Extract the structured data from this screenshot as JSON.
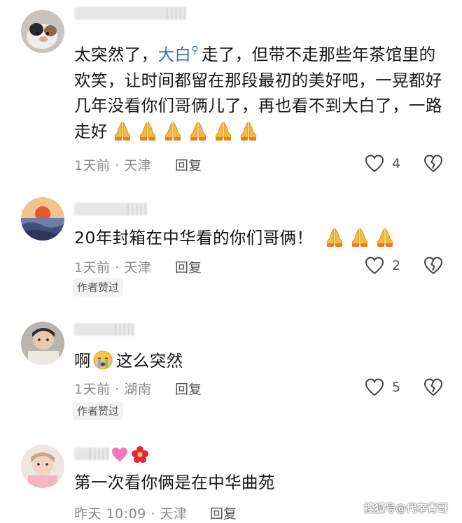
{
  "comments": [
    {
      "text_before": "太突然了，",
      "link_text": "大白",
      "link_icon": "search-icon",
      "text_after": "走了，但带不走那些年茶馆里的欢笑，让时间都留在那段最初的美好吧，一晃都好几年没看你们哥俩儿了，再也看不到大白了，一路走好",
      "emoji": [
        "folded-hands",
        "folded-hands",
        "folded-hands",
        "folded-hands",
        "folded-hands",
        "folded-hands"
      ],
      "time": "1天前",
      "location": "天津",
      "reply_label": "回复",
      "likes": "4"
    },
    {
      "text": "20年封箱在中华看的你们哥俩！",
      "emoji": [
        "folded-hands",
        "folded-hands",
        "folded-hands"
      ],
      "time": "1天前",
      "location": "天津",
      "reply_label": "回复",
      "likes": "2",
      "author_liked": "作者赞过"
    },
    {
      "text_before": "啊",
      "emoji_inline": "crying-face",
      "text_after": "这么突然",
      "time": "1天前",
      "location": "湖南",
      "reply_label": "回复",
      "likes": "5",
      "author_liked": "作者赞过"
    },
    {
      "name_emoji": [
        "heart",
        "flower"
      ],
      "text": "第一次看你俩是在中华曲苑",
      "time": "昨天 10:09",
      "location": "天津",
      "reply_label": "回复"
    }
  ],
  "separator": "·",
  "watermark": "搜狐号@代宰青哥",
  "colors": {
    "link": "#3b69c8",
    "meta": "#8a8a8a",
    "emoji_yellow": "#f6b93b",
    "emoji_cuff": "#f09020"
  }
}
